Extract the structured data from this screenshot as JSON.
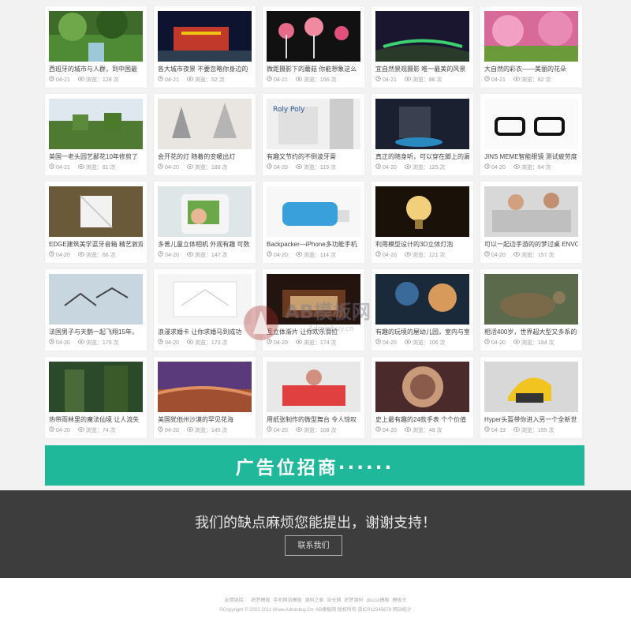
{
  "grid": {
    "cards": [
      {
        "title": "西班牙的城市与人群，到中国最",
        "date": "04-21",
        "views": "浏览：128 次"
      },
      {
        "title": "各大城市夜景 不要忽略你身边的",
        "date": "04-21",
        "views": "浏览：52 次"
      },
      {
        "title": "微距摄影下的蘑菇 你能想象这么",
        "date": "04-21",
        "views": "浏览：156 次"
      },
      {
        "title": "宜自然景观摄影 唯一最美的风景",
        "date": "04-21",
        "views": "浏览：86 次"
      },
      {
        "title": "大自然的彩衣——美丽的花朵",
        "date": "04-21",
        "views": "浏览：82 次"
      },
      {
        "title": "英国一老头园艺鄙花10年修剪了",
        "date": "04-21",
        "views": "浏览：81 次"
      },
      {
        "title": "会开花的灯 随着的变暖出灯",
        "date": "04-20",
        "views": "浏览：188 次"
      },
      {
        "title": "有趣又节约的不倒波牙膏",
        "date": "04-20",
        "views": "浏览：119 次"
      },
      {
        "title": "真正的随身听，可以穿在脚上的漏",
        "date": "04-20",
        "views": "浏览：125 次"
      },
      {
        "title": "JINS MEME智能眼镜 测试疲劳度",
        "date": "04-20",
        "views": "浏览：64 次"
      },
      {
        "title": "EDGE建筑美学蓝牙音箱 精艺敦观",
        "date": "04-20",
        "views": "浏览：66 次"
      },
      {
        "title": "多普儿童立体相机 外观有趣 可数",
        "date": "04-20",
        "views": "浏览：147 次"
      },
      {
        "title": "Backpacker—iPhone多功能手机",
        "date": "04-20",
        "views": "浏览：114 次"
      },
      {
        "title": "利用模型设计的3D立体灯泡",
        "date": "04-20",
        "views": "浏览：121 次"
      },
      {
        "title": "可以一起边手游的的梦过桌 ENVO",
        "date": "04-20",
        "views": "浏览：157 次"
      },
      {
        "title": "法国男子与天鹅一起飞翔15年，",
        "date": "04-20",
        "views": "浏览：179 次"
      },
      {
        "title": "浪漫求婚卡 让你求婚马到成功",
        "date": "04-20",
        "views": "浏览：173 次"
      },
      {
        "title": "互立体渐片 让你欢乐滑拉",
        "date": "04-20",
        "views": "浏览：174 次"
      },
      {
        "title": "有趣的玩境的屋幼儿园，室内与室",
        "date": "04-20",
        "views": "浏览：106 次"
      },
      {
        "title": "相活400岁，世界超大型又多系的",
        "date": "04-20",
        "views": "浏览：194 次"
      },
      {
        "title": "热带雨林里的魔法仙境 让人流失",
        "date": "04-20",
        "views": "浏览：74 次"
      },
      {
        "title": "美国犹他州沙漠的罕见花海",
        "date": "04-20",
        "views": "浏览：145 次"
      },
      {
        "title": "用纸张制作的微型舞台 令人惊叹",
        "date": "04-20",
        "views": "浏览：108 次"
      },
      {
        "title": "史上最有趣的24款手表 个个价值",
        "date": "04-20",
        "views": "浏览：49 次"
      },
      {
        "title": "Hyper头盔带你进入另一个全新世",
        "date": "04-19",
        "views": "浏览：155 次"
      }
    ]
  },
  "ad": {
    "text": "广告位招商······"
  },
  "footer": {
    "message": "我们的缺点麻烦您能提出，谢谢支持！",
    "contact_label": "联系我们",
    "links": [
      "友情链接：",
      "织梦模板",
      "手机网站模板",
      "源码之家",
      "站长网",
      "织梦源码",
      "discuz模板",
      "模板王"
    ],
    "copyright": "©Copyright © 2002-2011 Www.Adminbuy.Cn. AB模板网 版权所有 浙ICP12345678 网站统计"
  },
  "watermark": {
    "brand": "AB模板网",
    "sub": "Adminbuy.cn"
  },
  "colors": {
    "accent": "#1fb89a",
    "footer_dark": "#3d3d3d"
  }
}
